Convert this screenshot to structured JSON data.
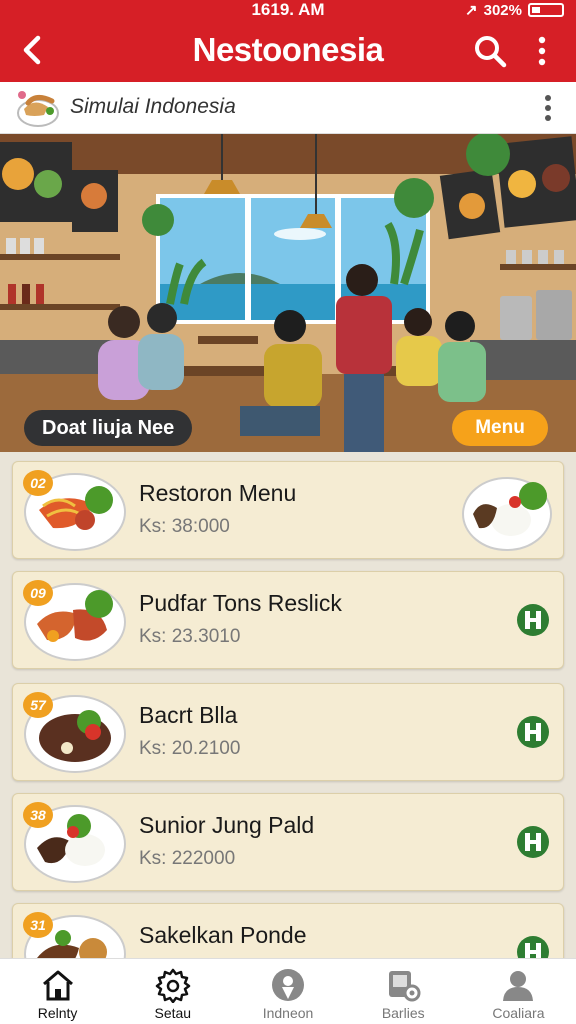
{
  "status_bar": {
    "time": "1619. AM",
    "battery": "302%"
  },
  "app_bar": {
    "title": "Nestoonesia",
    "back_icon": "arrow-left-icon",
    "search_icon": "search-icon",
    "more_icon": "more-vertical-icon"
  },
  "sub_header": {
    "subtitle": "Simulai Indonesia"
  },
  "hero": {
    "left_pill": "Doat liuja Nee",
    "right_pill": "Menu"
  },
  "menu_items": [
    {
      "badge": "02",
      "name": "Restoron Menu",
      "price": "Ks: 38:000"
    },
    {
      "badge": "09",
      "name": "Pudfar Tons Reslick",
      "price": "Ks: 23.3010"
    },
    {
      "badge": "57",
      "name": "Bacrt Blla",
      "price": "Ks: 20.2100"
    },
    {
      "badge": "38",
      "name": "Sunior Jung Pald",
      "price": "Ks: 222000"
    },
    {
      "badge": "31",
      "name": "Sakelkan Ponde",
      "price": ""
    }
  ],
  "bottom_nav": [
    {
      "label": "Relnty",
      "icon": "home-icon",
      "active": true
    },
    {
      "label": "Setau",
      "icon": "settings-gear-icon",
      "active": false
    },
    {
      "label": "Indneon",
      "icon": "location-icon",
      "active": false
    },
    {
      "label": "Barlies",
      "icon": "gallery-settings-icon",
      "active": false
    },
    {
      "label": "Coaliara",
      "icon": "profile-icon",
      "active": false
    }
  ],
  "colors": {
    "primary": "#d61f26",
    "accent": "#f6a21a",
    "card_bg": "#f5ecd3",
    "add_button": "#2e7d32"
  }
}
